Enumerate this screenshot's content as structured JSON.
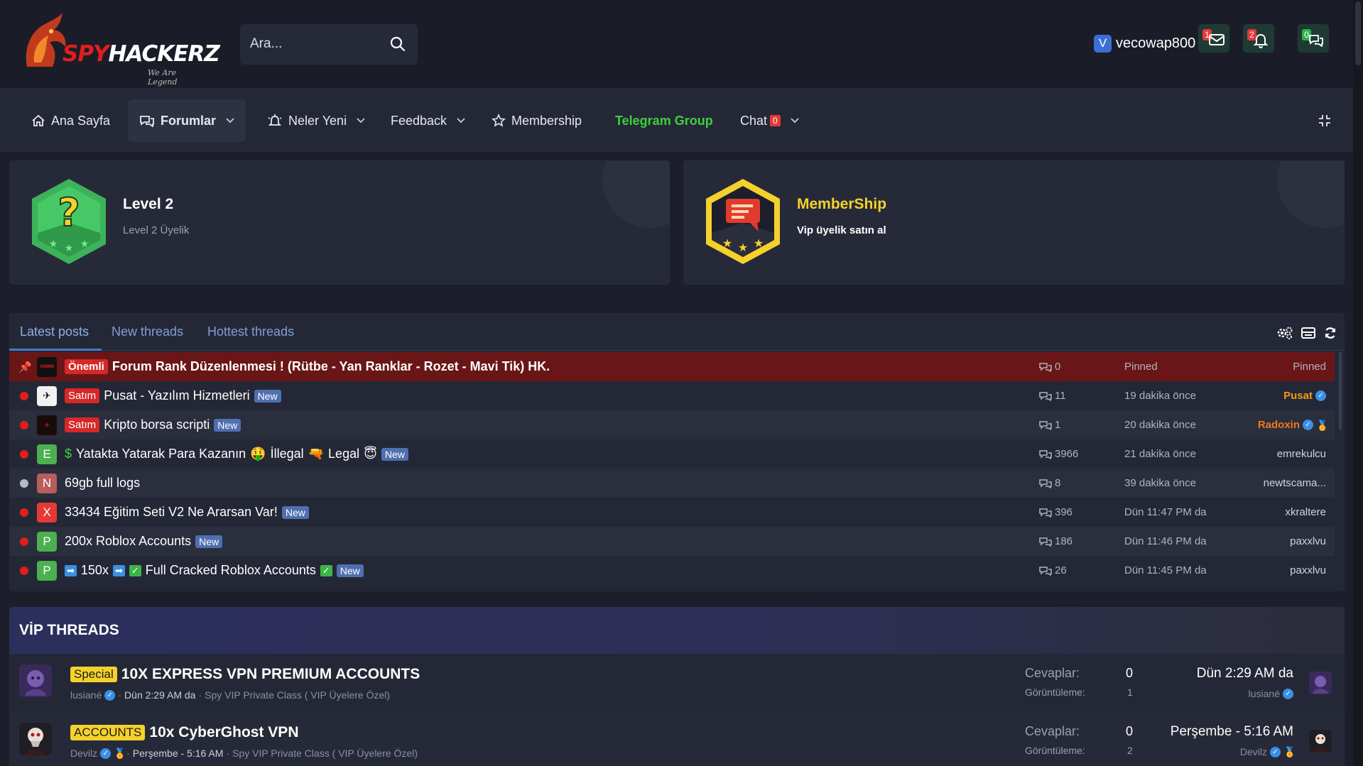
{
  "header": {
    "logo_text_a": "SPY",
    "logo_text_b": "HACKERZ",
    "logo_tagline": "We Are Legend",
    "search_placeholder": "Ara...",
    "user_initial": "V",
    "username": "vecowap800",
    "inbox_count": "1",
    "alerts_count": "2",
    "chat_count": "0"
  },
  "nav": {
    "home": "Ana Sayfa",
    "forums": "Forumlar",
    "whats_new": "Neler Yeni",
    "feedback": "Feedback",
    "membership": "Membership",
    "telegram": "Telegram Group",
    "chat": "Chat",
    "chat_count": "0"
  },
  "cards": {
    "level": {
      "title": "Level 2",
      "subtitle": "Level 2 Üyelik"
    },
    "member": {
      "title": "MemberShip",
      "subtitle": "Vip üyelik satın al"
    }
  },
  "posts": {
    "tabs": [
      "Latest posts",
      "New threads",
      "Hottest threads"
    ],
    "new_label": "New",
    "rows": [
      {
        "prefix": "Önemli",
        "title": "Forum Rank Düzenlenmesi ! (Rütbe - Yan Ranklar - Rozet - Mavi Tik) HK.",
        "replies": "0",
        "time": "Pinned",
        "author": "Pinned",
        "avatar": "ADMIN"
      },
      {
        "prefix": "Satım",
        "title": "Pusat - Yazılım Hizmetleri",
        "replies": "11",
        "time": "19 dakika önce",
        "author": "Pusat",
        "avatar": ""
      },
      {
        "prefix": "Satım",
        "title": "Kripto borsa scripti",
        "replies": "1",
        "time": "20 dakika önce",
        "author": "Radoxin",
        "avatar": ""
      },
      {
        "prefix": "",
        "title_a": "Yatakta Yatarak Para Kazanın",
        "title_b": "İllegal",
        "title_c": "Legal",
        "replies": "3966",
        "time": "21 dakika önce",
        "author": "emrekulcu",
        "avatar": "E"
      },
      {
        "prefix": "",
        "title": "69gb full logs",
        "replies": "8",
        "time": "39 dakika önce",
        "author": "newtscama...",
        "avatar": "N"
      },
      {
        "prefix": "",
        "title": "33434 Eğitim Seti V2 Ne Ararsan Var!",
        "replies": "396",
        "time": "Dün 11:47 PM da",
        "author": "xkraltere",
        "avatar": "X"
      },
      {
        "prefix": "",
        "title": "200x Roblox Accounts",
        "replies": "186",
        "time": "Dün 11:46 PM da",
        "author": "paxxlvu",
        "avatar": "P"
      },
      {
        "prefix": "",
        "title_a": "150x",
        "title_b": "Full Cracked Roblox Accounts",
        "replies": "26",
        "time": "Dün 11:45 PM da",
        "author": "paxxlvu",
        "avatar": "P"
      }
    ]
  },
  "vip": {
    "heading": "VİP THREADS",
    "replies_label": "Cevaplar:",
    "views_label": "Görüntüleme:",
    "threads": [
      {
        "prefix": "Special",
        "title": "10X EXPRESS VPN PREMIUM ACCOUNTS",
        "author": "lusiané",
        "date": "Dün 2:29 AM da",
        "forum": "Spy VIP Private Class ( VIP Üyelere Özel)",
        "replies": "0",
        "views": "1",
        "last_date": "Dün 2:29 AM da",
        "last_user": "lusiané"
      },
      {
        "prefix": "ACCOUNTS",
        "title": "10x CyberGhost VPN",
        "author": "Devilz",
        "date": "Perşembe - 5:16 AM",
        "forum": "Spy VIP Private Class ( VIP Üyelere Özel)",
        "replies": "0",
        "views": "2",
        "last_date": "Perşembe - 5:16 AM",
        "last_user": "Devilz"
      }
    ]
  },
  "colors": {
    "accent_blue": "#4a78c8",
    "telegram_green": "#3bd23b",
    "membership_yellow": "#f4d22b",
    "unread_red": "#e31d1d"
  }
}
